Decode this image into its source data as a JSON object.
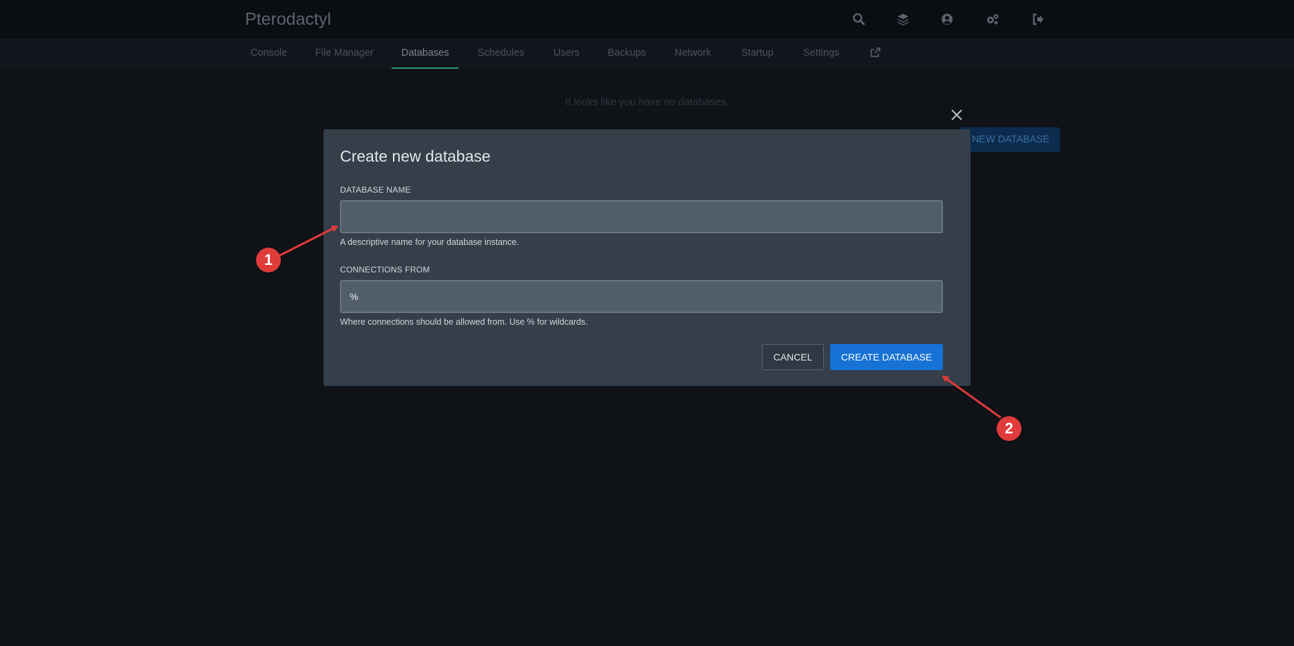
{
  "app": {
    "brand": "Pterodactyl"
  },
  "header_icons": [
    "search-icon",
    "layers-icon",
    "account-icon",
    "cogs-icon",
    "sign-out-icon"
  ],
  "tabs": [
    {
      "label": "Console"
    },
    {
      "label": "File Manager"
    },
    {
      "label": "Databases",
      "active": true
    },
    {
      "label": "Schedules"
    },
    {
      "label": "Users"
    },
    {
      "label": "Backups"
    },
    {
      "label": "Network"
    },
    {
      "label": "Startup"
    },
    {
      "label": "Settings"
    }
  ],
  "background": {
    "empty_message": "It looks like you have no databases.",
    "new_database_label": "NEW DATABASE"
  },
  "modal": {
    "title": "Create new database",
    "database_name": {
      "label": "DATABASE NAME",
      "value": "",
      "help": "A descriptive name for your database instance."
    },
    "connections_from": {
      "label": "CONNECTIONS FROM",
      "value": "%",
      "help": "Where connections should be allowed from. Use % for wildcards."
    },
    "cancel_label": "CANCEL",
    "create_label": "CREATE DATABASE"
  },
  "annotations": {
    "badge_1": "1",
    "badge_2": "2",
    "color": "#e03b3b"
  },
  "colors": {
    "accent": "#1672d4",
    "active_tab_underline": "#2a9c7a"
  }
}
